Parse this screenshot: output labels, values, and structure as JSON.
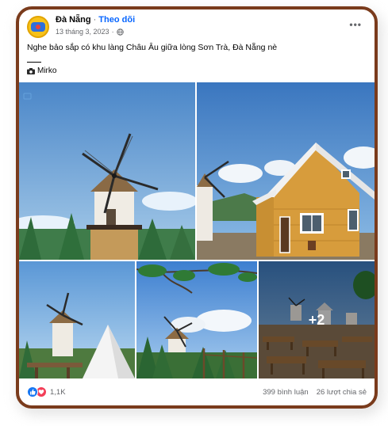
{
  "post": {
    "page_name": "Đà Nẵng",
    "separator": "·",
    "follow_label": "Theo dõi",
    "date": "13 tháng 3, 2023",
    "date_separator": "·",
    "more_label": "•••",
    "caption": "Nghe bảo sắp có khu làng Châu Âu giữa lòng Sơn Trà, Đà Nẵng nè",
    "credit": "Mirko"
  },
  "gallery": {
    "extra_count": "+2"
  },
  "footer": {
    "reaction_count": "1,1K",
    "comments": "399 bình luận",
    "shares": "26 lượt chia sẻ"
  },
  "icons": {
    "audience": "globe-icon",
    "credit": "camera-icon",
    "like": "like-icon",
    "love": "love-icon"
  },
  "colors": {
    "frame": "#7a3b1c",
    "follow": "#0866ff",
    "like": "#1877f2",
    "love": "#f33e58"
  }
}
